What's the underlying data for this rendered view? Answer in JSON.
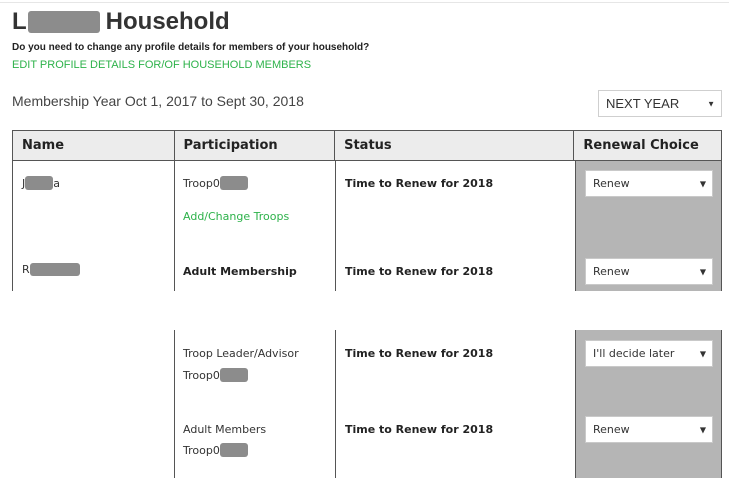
{
  "header": {
    "title_initial": "L",
    "title_suffix": "Household",
    "question": "Do you need to change any profile details for members of your household?",
    "edit_link": "EDIT PROFILE DETAILS FOR/OF HOUSEHOLD MEMBERS"
  },
  "membership_year": {
    "label": "Membership Year Oct 1, 2017 to Sept 30, 2018",
    "select_value": "NEXT YEAR"
  },
  "table": {
    "columns": [
      "Name",
      "Participation",
      "Status",
      "Renewal Choice"
    ],
    "rows": [
      {
        "name_start": "J",
        "name_end": "a",
        "participation": "Troop0",
        "link": "Add/Change Troops",
        "status": "Time to Renew for 2018",
        "choice": "Renew"
      },
      {
        "name_start": "R",
        "participation": "Adult Membership",
        "status": "Time to Renew for 2018",
        "choice": "Renew"
      },
      {
        "participation_line1": "Troop Leader/Advisor",
        "participation_line2": "Troop0",
        "status": "Time to Renew for 2018",
        "choice": "I'll decide later"
      },
      {
        "participation_line1": "Adult Members",
        "participation_line2": "Troop0",
        "status": "Time to Renew for 2018",
        "choice": "Renew"
      }
    ]
  },
  "colors": {
    "link_green": "#2db24a",
    "renew_column_bg": "#b5b5b5",
    "redaction": "#8c8c8c"
  }
}
